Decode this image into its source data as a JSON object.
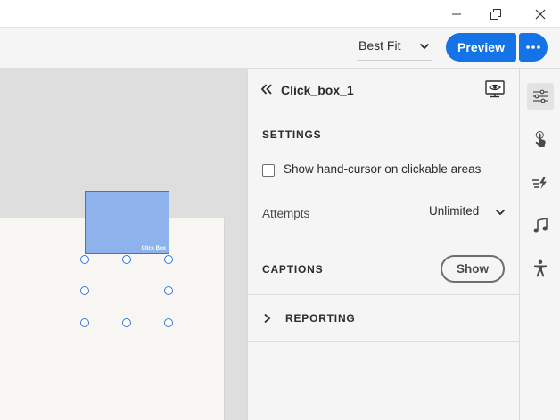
{
  "window": {
    "minimize_icon": "minimize-icon",
    "restore_icon": "restore-icon",
    "close_icon": "close-icon"
  },
  "toolbar": {
    "zoom_value": "Best Fit",
    "preview_label": "Preview",
    "more_icon": "more-icon",
    "accent_color": "#1473e6"
  },
  "stage": {
    "click_box_caption": "Click Box"
  },
  "panel": {
    "object_name": "Click_box_1",
    "settings": {
      "title": "SETTINGS",
      "hand_cursor_label": "Show hand-cursor on clickable areas",
      "hand_cursor_checked": false,
      "attempts_label": "Attempts",
      "attempts_value": "Unlimited"
    },
    "captions": {
      "title": "CAPTIONS",
      "show_label": "Show"
    },
    "reporting": {
      "title": "REPORTING"
    }
  },
  "rail": {
    "items": [
      "properties-icon",
      "interaction-icon",
      "animation-icon",
      "audio-icon",
      "accessibility-icon"
    ],
    "active_index": 0
  }
}
